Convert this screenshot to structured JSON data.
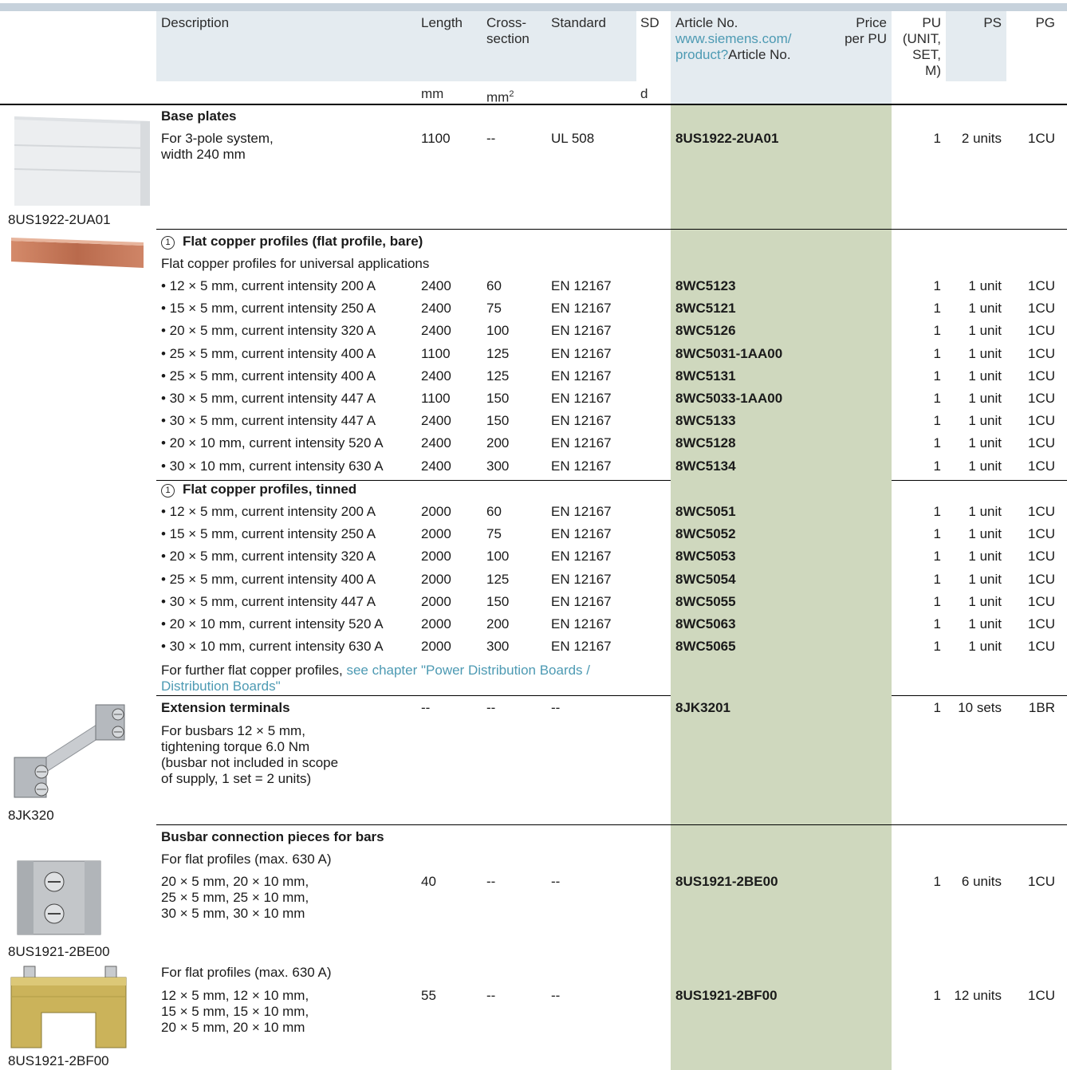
{
  "header": {
    "description": "Description",
    "length": "Length",
    "cross_line1": "Cross-",
    "cross_line2": "section",
    "standard": "Standard",
    "sd": "SD",
    "article": "Article No.",
    "article_link1": "www.siemens.com/",
    "article_link2": "product?",
    "article_link_suffix": "Article No.",
    "price1": "Price",
    "price2": "per PU",
    "pu1": "PU",
    "pu2": "(UNIT,",
    "pu3": "SET,",
    "pu4": "M)",
    "ps": "PS",
    "pg": "PG",
    "unit_length": "mm",
    "unit_cross": "mm",
    "unit_cross_sup": "2",
    "unit_sd": "d"
  },
  "base_plates": {
    "title": "Base plates",
    "desc_line1": "For 3-pole system,",
    "desc_line2": "width 240 mm",
    "length": "1100",
    "cross": "--",
    "standard": "UL 508",
    "article": "8US1922-2UA01",
    "pu": "1",
    "ps": "2 units",
    "pg": "1CU",
    "image_caption": "8US1922-2UA01"
  },
  "bare": {
    "marker": "1",
    "title": "Flat copper profiles (flat profile, bare)",
    "subtitle": "Flat copper profiles for universal applications",
    "rows": [
      {
        "desc": "• 12 × 5 mm, current intensity 200 A",
        "length": "2400",
        "cross": "60",
        "standard": "EN 12167",
        "article": "8WC5123",
        "pu": "1",
        "ps": "1 unit",
        "pg": "1CU"
      },
      {
        "desc": "• 15 × 5 mm, current intensity 250 A",
        "length": "2400",
        "cross": "75",
        "standard": "EN 12167",
        "article": "8WC5121",
        "pu": "1",
        "ps": "1 unit",
        "pg": "1CU"
      },
      {
        "desc": "• 20 × 5 mm, current intensity 320 A",
        "length": "2400",
        "cross": "100",
        "standard": "EN 12167",
        "article": "8WC5126",
        "pu": "1",
        "ps": "1 unit",
        "pg": "1CU"
      },
      {
        "desc": "• 25 × 5 mm, current intensity 400 A",
        "length": "1100",
        "cross": "125",
        "standard": "EN 12167",
        "article": "8WC5031-1AA00",
        "pu": "1",
        "ps": "1 unit",
        "pg": "1CU"
      },
      {
        "desc": "• 25 × 5 mm, current intensity 400 A",
        "length": "2400",
        "cross": "125",
        "standard": "EN 12167",
        "article": "8WC5131",
        "pu": "1",
        "ps": "1 unit",
        "pg": "1CU"
      },
      {
        "desc": "• 30 × 5 mm, current intensity 447 A",
        "length": "1100",
        "cross": "150",
        "standard": "EN 12167",
        "article": "8WC5033-1AA00",
        "pu": "1",
        "ps": "1 unit",
        "pg": "1CU"
      },
      {
        "desc": "• 30 × 5 mm, current intensity 447 A",
        "length": "2400",
        "cross": "150",
        "standard": "EN 12167",
        "article": "8WC5133",
        "pu": "1",
        "ps": "1 unit",
        "pg": "1CU"
      },
      {
        "desc": "• 20 × 10 mm, current intensity 520 A",
        "length": "2400",
        "cross": "200",
        "standard": "EN 12167",
        "article": "8WC5128",
        "pu": "1",
        "ps": "1 unit",
        "pg": "1CU"
      },
      {
        "desc": "• 30 × 10 mm, current intensity 630 A",
        "length": "2400",
        "cross": "300",
        "standard": "EN 12167",
        "article": "8WC5134",
        "pu": "1",
        "ps": "1 unit",
        "pg": "1CU"
      }
    ]
  },
  "tinned": {
    "marker": "1",
    "title": "Flat copper profiles, tinned",
    "rows": [
      {
        "desc": "• 12 × 5 mm, current intensity 200 A",
        "length": "2000",
        "cross": "60",
        "standard": "EN 12167",
        "article": "8WC5051",
        "pu": "1",
        "ps": "1 unit",
        "pg": "1CU"
      },
      {
        "desc": "• 15 × 5 mm, current intensity 250 A",
        "length": "2000",
        "cross": "75",
        "standard": "EN 12167",
        "article": "8WC5052",
        "pu": "1",
        "ps": "1 unit",
        "pg": "1CU"
      },
      {
        "desc": "• 20 × 5 mm, current intensity 320 A",
        "length": "2000",
        "cross": "100",
        "standard": "EN 12167",
        "article": "8WC5053",
        "pu": "1",
        "ps": "1 unit",
        "pg": "1CU"
      },
      {
        "desc": "• 25 × 5 mm, current intensity 400 A",
        "length": "2000",
        "cross": "125",
        "standard": "EN 12167",
        "article": "8WC5054",
        "pu": "1",
        "ps": "1 unit",
        "pg": "1CU"
      },
      {
        "desc": "• 30 × 5 mm, current intensity 447 A",
        "length": "2000",
        "cross": "150",
        "standard": "EN 12167",
        "article": "8WC5055",
        "pu": "1",
        "ps": "1 unit",
        "pg": "1CU"
      },
      {
        "desc": "• 20 × 10 mm, current intensity 520 A",
        "length": "2000",
        "cross": "200",
        "standard": "EN 12167",
        "article": "8WC5063",
        "pu": "1",
        "ps": "1 unit",
        "pg": "1CU"
      },
      {
        "desc": "• 30 × 10 mm, current intensity 630 A",
        "length": "2000",
        "cross": "300",
        "standard": "EN 12167",
        "article": "8WC5065",
        "pu": "1",
        "ps": "1 unit",
        "pg": "1CU"
      }
    ],
    "note_prefix": "For further flat copper profiles, ",
    "note_link1": "see chapter \"Power Distribution Boards /",
    "note_link2": "Distribution Boards\""
  },
  "extension": {
    "title": "Extension terminals",
    "length": "--",
    "cross": "--",
    "standard": "--",
    "article": "8JK3201",
    "pu": "1",
    "ps": "10 sets",
    "pg": "1BR",
    "desc_line1": "For busbars 12 × 5 mm,",
    "desc_line2": "tightening torque 6.0 Nm",
    "desc_line3": "(busbar not included in scope",
    "desc_line4": "of supply, 1 set = 2 units)",
    "image_caption": "8JK320"
  },
  "connection": {
    "title": "Busbar connection pieces for bars",
    "item1": {
      "subtitle": "For flat profiles (max. 630 A)",
      "line1": "20 × 5 mm, 20 × 10 mm,",
      "line2": "25 × 5 mm, 25 × 10 mm,",
      "line3": "30 × 5 mm, 30 × 10 mm",
      "length": "40",
      "cross": "--",
      "standard": "--",
      "article": "8US1921-2BE00",
      "pu": "1",
      "ps": "6 units",
      "pg": "1CU",
      "image_caption": "8US1921-2BE00"
    },
    "item2": {
      "subtitle": "For flat profiles (max. 630 A)",
      "line1": "12 × 5 mm, 12 × 10 mm,",
      "line2": "15 × 5 mm, 15 × 10 mm,",
      "line3": "20 × 5 mm, 20 × 10 mm",
      "length": "55",
      "cross": "--",
      "standard": "--",
      "article": "8US1921-2BF00",
      "pu": "1",
      "ps": "12 units",
      "pg": "1CU",
      "image_caption": "8US1921-2BF00"
    }
  },
  "colors": {
    "header_bg": "#e4ebf0",
    "article_column_bg": "#cfd8be",
    "link": "#4d9ab3",
    "top_bar": "#c7d2dc"
  }
}
